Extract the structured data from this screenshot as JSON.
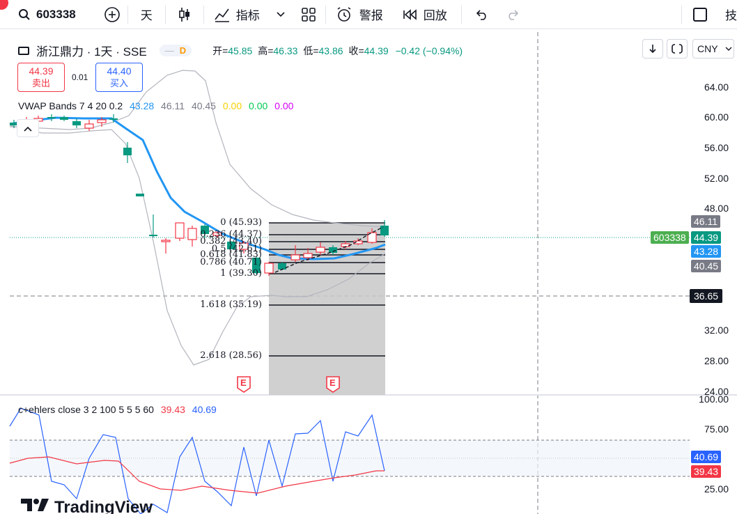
{
  "toolbar": {
    "symbol": "603338",
    "interval": "天",
    "indicators_label": "指标",
    "alert_label": "警报",
    "replay_label": "回放",
    "right_label": "技"
  },
  "legend": {
    "title": "浙江鼎力 · 1天 · SSE",
    "badge_dot": "—",
    "badge_d": "D",
    "open_k": "开=",
    "open_v": "45.85",
    "high_k": "高=",
    "high_v": "46.33",
    "low_k": "低=",
    "low_v": "43.86",
    "close_k": "收=",
    "close_v": "44.39",
    "change": "−0.42 (−0.94%)"
  },
  "trade": {
    "sell_price": "44.39",
    "sell_label": "卖出",
    "spread": "0.01",
    "buy_price": "44.40",
    "buy_label": "买入"
  },
  "vwap": {
    "name": "VWAP Bands 7 4 20 0.2",
    "v1": "43.28",
    "v2": "46.11",
    "v3": "40.45",
    "v4": "0.00",
    "v5": "0.00",
    "v6": "0.00"
  },
  "ehlers": {
    "name": "c+ehlers close 3 2 100 5 5 5 60",
    "v1": "39.43",
    "v2": "40.69"
  },
  "controls": {
    "currency": "CNY"
  },
  "price_axis": [
    "64.00",
    "60.00",
    "56.00",
    "52.00",
    "48.00",
    "32.00",
    "28.00",
    "24.00"
  ],
  "osc_axis": [
    "100.00",
    "75.00",
    "25.00"
  ],
  "tags": {
    "upper": "46.11",
    "last": "44.39",
    "vwap": "43.28",
    "lower": "40.45",
    "crosshair": "36.65",
    "symbol": "603338",
    "osc_blue": "40.69",
    "osc_red": "39.43"
  },
  "fib_levels": [
    {
      "label": "0 (45.93)"
    },
    {
      "label": "0.236 (44.37)"
    },
    {
      "label": "0.382 (43.40)"
    },
    {
      "label": "0.5 (42.61)"
    },
    {
      "label": "0.618 (41.83)"
    },
    {
      "label": "0.786 (40.71)"
    },
    {
      "label": "1 (39.30)"
    },
    {
      "label": "1.618 (35.19)"
    },
    {
      "label": "2.618 (28.56)"
    }
  ],
  "earnings_marker": "E",
  "branding": "TradingView",
  "colors": {
    "up": "#f23645",
    "down": "#089981",
    "vwap": "#2196f3",
    "yellow": "#f5d000",
    "green": "#00c853",
    "magenta": "#d500f9"
  }
}
